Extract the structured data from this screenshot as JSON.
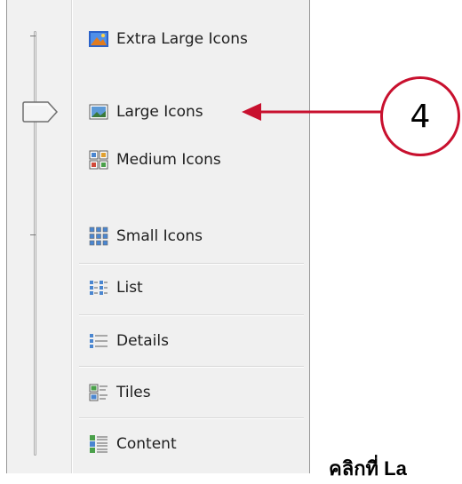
{
  "view_menu": {
    "slider": {
      "selected": "Large Icons"
    },
    "items": [
      {
        "label": "Extra Large Icons",
        "icon": "extra-large-icons-icon"
      },
      {
        "label": "Large Icons",
        "icon": "large-icons-icon"
      },
      {
        "label": "Medium Icons",
        "icon": "medium-icons-icon"
      },
      {
        "label": "Small Icons",
        "icon": "small-icons-icon"
      },
      {
        "label": "List",
        "icon": "list-icon"
      },
      {
        "label": "Details",
        "icon": "details-icon"
      },
      {
        "label": "Tiles",
        "icon": "tiles-icon"
      },
      {
        "label": "Content",
        "icon": "content-icon"
      }
    ]
  },
  "annotation": {
    "step_number": "4",
    "caption": "คลิกที่ La",
    "color": "#c8102e"
  }
}
